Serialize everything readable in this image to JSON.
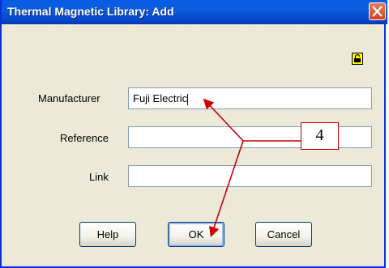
{
  "window": {
    "title": "Thermal Magnetic Library: Add",
    "close_icon": "close-icon"
  },
  "form": {
    "manufacturer_label": "Manufacturer",
    "manufacturer_value": "Fuji Electric",
    "reference_label": "Reference",
    "reference_value": "",
    "link_label": "Link",
    "link_value": ""
  },
  "buttons": {
    "help": "Help",
    "ok": "OK",
    "cancel": "Cancel"
  },
  "annotation": {
    "callout_number": "4",
    "color": "#CC0000"
  },
  "icons": {
    "lock": "lock-icon"
  }
}
